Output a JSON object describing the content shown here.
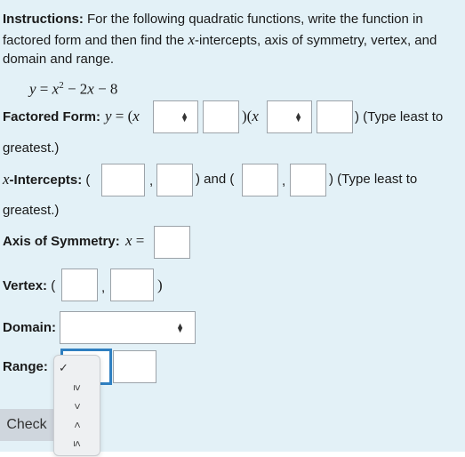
{
  "instructions": {
    "label": "Instructions:",
    "line1": " For the following quadratic functions, write the function in",
    "line2a": "factored form and then find the ",
    "line2_var": "x",
    "line2b": "-intercepts, axis of symmetry, vertex, and",
    "line3": "domain and range."
  },
  "equation": "y = x² − 2x − 8",
  "factored": {
    "label": "Factored Form:",
    "prefix": "y = (x",
    "middle": ")(x",
    "suffix": ") (Type least to",
    "wrap": "greatest.)",
    "sign_select_1": "",
    "value_1": "",
    "sign_select_2": "",
    "value_2": ""
  },
  "intercepts": {
    "var": "x",
    "label": "-Intercepts:",
    "open1": "(",
    "comma": ",",
    "and": ") and (",
    "suffix": ") (Type least to",
    "wrap": "greatest.)"
  },
  "axis": {
    "label": "Axis of Symmetry:",
    "eq": "x ="
  },
  "vertex": {
    "label": "Vertex:",
    "open": "(",
    "comma": ",",
    "close": ")"
  },
  "domain": {
    "label": "Domain:",
    "selected": ""
  },
  "range": {
    "label": "Range:",
    "selected": ""
  },
  "range_dropdown": {
    "options": [
      {
        "label": "",
        "checked": true,
        "tick": "✓"
      },
      {
        "label": "≥",
        "checked": false
      },
      {
        "label": ">",
        "checked": false
      },
      {
        "label": "<",
        "checked": false
      },
      {
        "label": "≤",
        "checked": false
      }
    ]
  },
  "check_button": "Check",
  "colors": {
    "panel_bg": "#e3f1f7",
    "focus": "#2f7fc1",
    "button_bg": "#cfd6dd"
  }
}
